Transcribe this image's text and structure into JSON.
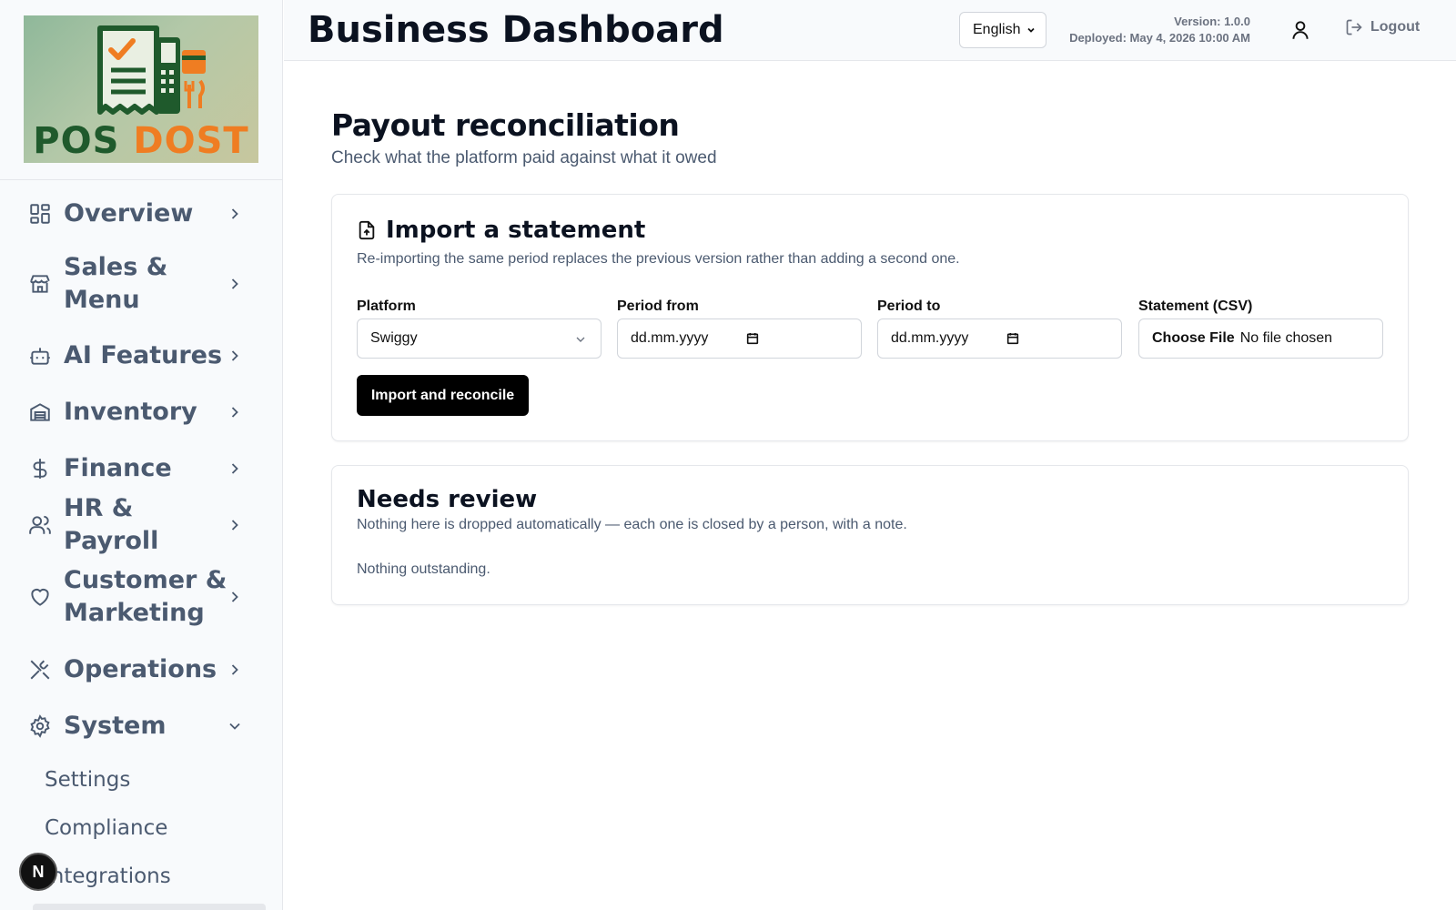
{
  "brand": {
    "logo_word1": "POS",
    "logo_word2": "DOST"
  },
  "sidebar": {
    "items": [
      {
        "label": "Overview",
        "icon": "layout-grid-icon",
        "expanded": false
      },
      {
        "label": "Sales & Menu",
        "icon": "store-icon",
        "expanded": false
      },
      {
        "label": "AI Features",
        "icon": "bot-icon",
        "expanded": false
      },
      {
        "label": "Inventory",
        "icon": "warehouse-icon",
        "expanded": false
      },
      {
        "label": "Finance",
        "icon": "dollar-icon",
        "expanded": false
      },
      {
        "label": "HR & Payroll",
        "icon": "users-icon",
        "expanded": false
      },
      {
        "label": "Customer & Marketing",
        "icon": "heart-icon",
        "expanded": false
      },
      {
        "label": "Operations",
        "icon": "utensils-crossed-icon",
        "expanded": false
      },
      {
        "label": "System",
        "icon": "gear-icon",
        "expanded": true
      }
    ],
    "system_subitems": [
      {
        "label": "Settings"
      },
      {
        "label": "Compliance"
      },
      {
        "label": "Integrations"
      }
    ],
    "floating_badge": "N"
  },
  "header": {
    "title": "Business Dashboard",
    "language": "English",
    "version": "Version: 1.0.0",
    "deployed": "Deployed: May 4, 2026 10:00 AM",
    "logout_label": "Logout"
  },
  "page": {
    "title": "Payout reconciliation",
    "subtitle": "Check what the platform paid against what it owed"
  },
  "import_card": {
    "title": "Import a statement",
    "description": "Re-importing the same period replaces the previous version rather than adding a second one.",
    "fields": {
      "platform_label": "Platform",
      "platform_value": "Swiggy",
      "period_from_label": "Period from",
      "period_from_placeholder": "dd.mm.yyyy",
      "period_to_label": "Period to",
      "period_to_placeholder": "dd.mm.yyyy",
      "statement_label": "Statement (CSV)",
      "file_button": "Choose File",
      "file_status": "No file chosen"
    },
    "submit_label": "Import and reconcile"
  },
  "review_card": {
    "title": "Needs review",
    "description": "Nothing here is dropped automatically — each one is closed by a person, with a note.",
    "empty_text": "Nothing outstanding."
  },
  "colors": {
    "accent": "#000000",
    "muted_text": "#4b5a70",
    "brand_green": "#1f5a2c",
    "brand_orange": "#ef7d22"
  }
}
